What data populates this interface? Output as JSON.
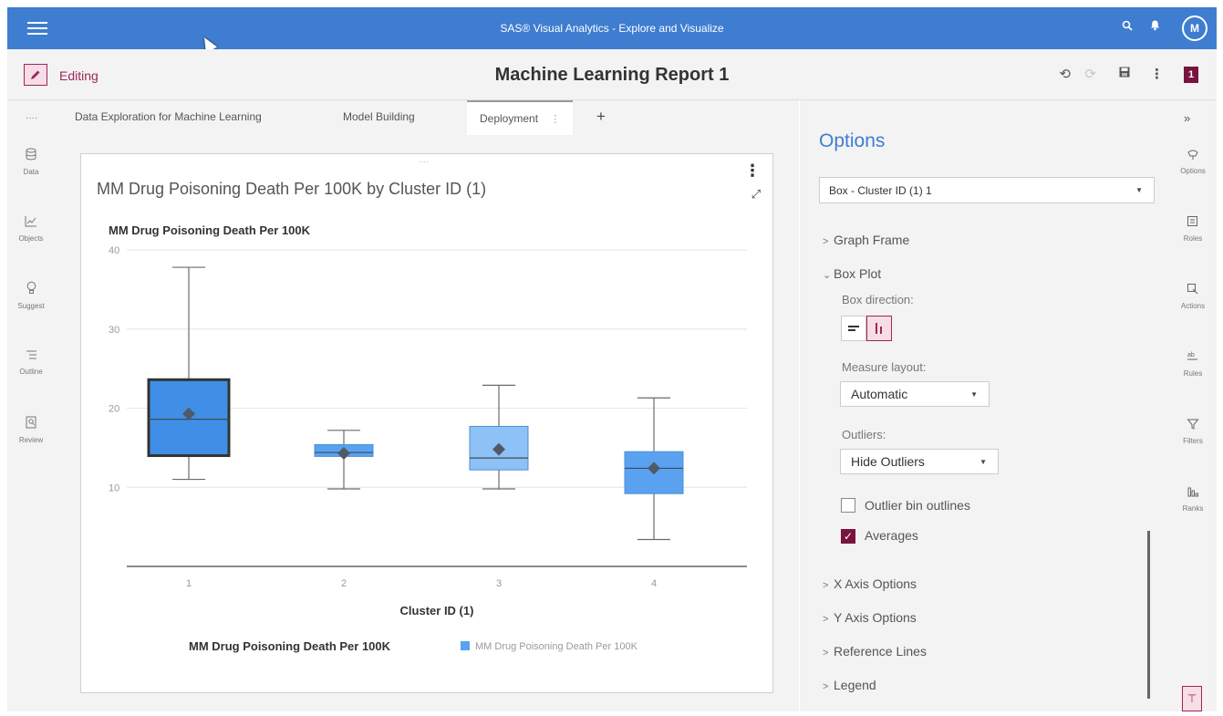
{
  "app": {
    "title": "SAS® Visual Analytics - Explore and Visualize",
    "avatar_initial": "M",
    "accent_color": "#3e7dd0",
    "edit_color": "#9c2758"
  },
  "report": {
    "mode_label": "Editing",
    "title": "Machine Learning Report 1",
    "page_badge": "1"
  },
  "left_tools": {
    "dots": "····",
    "items": [
      {
        "label": "Data",
        "icon": "database-icon"
      },
      {
        "label": "Objects",
        "icon": "chart-icon"
      },
      {
        "label": "Suggest",
        "icon": "lightbulb-icon"
      },
      {
        "label": "Outline",
        "icon": "list-icon"
      },
      {
        "label": "Review",
        "icon": "review-icon"
      }
    ]
  },
  "tabs": [
    {
      "label": "Data Exploration for Machine Learning",
      "active": false
    },
    {
      "label": "Model Building",
      "active": false
    },
    {
      "label": "Deployment",
      "active": true
    }
  ],
  "object": {
    "title": "MM Drug Poisoning Death Per 100K by Cluster ID (1)",
    "grip": "····"
  },
  "chart_data": {
    "type": "box",
    "ylabel": "MM Drug Poisoning Death Per 100K",
    "xlabel": "Cluster ID (1)",
    "ylim": [
      0,
      40
    ],
    "y_ticks": [
      "10",
      "20",
      "30",
      "40"
    ],
    "categories": [
      "1",
      "2",
      "3",
      "4"
    ],
    "boxes": [
      {
        "category": "1",
        "min": 11,
        "q1": 14,
        "median": 18.6,
        "q3": 23.6,
        "max": 37.8,
        "mean": 19.3
      },
      {
        "category": "2",
        "min": 9.8,
        "q1": 13.9,
        "median": 14.4,
        "q3": 15.4,
        "max": 17.2,
        "mean": 14.3
      },
      {
        "category": "3",
        "min": 9.8,
        "q1": 12.2,
        "median": 13.7,
        "q3": 17.7,
        "max": 22.9,
        "mean": 14.8
      },
      {
        "category": "4",
        "min": 3.4,
        "q1": 9.2,
        "median": 12.4,
        "q3": 14.5,
        "max": 21.3,
        "mean": 12.4
      }
    ],
    "legend": {
      "title": "MM Drug Poisoning Death Per 100K",
      "entries": [
        "MM Drug Poisoning Death Per 100K"
      ],
      "placement": "bottom"
    },
    "colors": {
      "box": "#5aa2f0",
      "box_selected": "#3f8fe6",
      "box_light": "#8ec1f5",
      "mean_marker": "#505a66",
      "whisker": "#6b6b6b"
    }
  },
  "options": {
    "title": "Options",
    "object_select": "Box - Cluster ID (1) 1",
    "sections": {
      "graph_frame": "Graph Frame",
      "box_plot": "Box Plot",
      "x_axis": "X Axis Options",
      "y_axis": "Y Axis Options",
      "reference_lines": "Reference Lines",
      "legend": "Legend"
    },
    "box_direction_label": "Box direction:",
    "measure_layout_label": "Measure layout:",
    "measure_layout_value": "Automatic",
    "outliers_label": "Outliers:",
    "outliers_value": "Hide Outliers",
    "outlier_bin_outlines_label": "Outlier bin outlines",
    "outlier_bin_outlines_checked": false,
    "averages_label": "Averages",
    "averages_checked": true
  },
  "right_rail": {
    "collapse": "»",
    "items": [
      {
        "label": "Options",
        "icon": "options-icon"
      },
      {
        "label": "Roles",
        "icon": "roles-icon"
      },
      {
        "label": "Actions",
        "icon": "actions-icon"
      },
      {
        "label": "Rules",
        "icon": "rules-icon"
      },
      {
        "label": "Filters",
        "icon": "filter-icon"
      },
      {
        "label": "Ranks",
        "icon": "ranks-icon"
      }
    ]
  }
}
